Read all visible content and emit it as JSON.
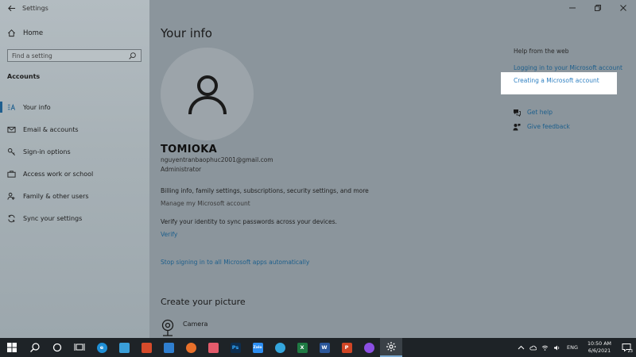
{
  "window": {
    "title": "Settings"
  },
  "sidebar": {
    "home_label": "Home",
    "search_placeholder": "Find a setting",
    "section_title": "Accounts",
    "items": [
      {
        "label": "Your info",
        "icon": "person-card-icon",
        "active": true
      },
      {
        "label": "Email & accounts",
        "icon": "email-icon",
        "active": false
      },
      {
        "label": "Sign-in options",
        "icon": "key-icon",
        "active": false
      },
      {
        "label": "Access work or school",
        "icon": "briefcase-icon",
        "active": false
      },
      {
        "label": "Family & other users",
        "icon": "people-icon",
        "active": false
      },
      {
        "label": "Sync your settings",
        "icon": "sync-icon",
        "active": false
      }
    ]
  },
  "main": {
    "page_title": "Your info",
    "user": {
      "name": "TOMIOKA",
      "email": "nguyentranbaophuc2001@gmail.com",
      "role": "Administrator"
    },
    "billing_text": "Billing info, family settings, subscriptions, security settings, and more",
    "manage_link": "Manage my Microsoft account",
    "verify_text": "Verify your identity to sync passwords across your devices.",
    "verify_link": "Verify",
    "stop_link": "Stop signing in to all Microsoft apps automatically",
    "picture_section_title": "Create your picture",
    "camera_label": "Camera"
  },
  "help": {
    "title": "Help from the web",
    "links": [
      "Logging in to your Microsoft account",
      "Creating a Microsoft account"
    ],
    "get_help": "Get help",
    "give_feedback": "Give feedback"
  },
  "taskbar": {
    "apps": [
      {
        "name": "Edge",
        "letter": "e",
        "color": "#1f8fd6"
      },
      {
        "name": "Store",
        "letter": "",
        "color": "#3a9fd9"
      },
      {
        "name": "Microsoft Store",
        "letter": "",
        "color": "#d64b2b"
      },
      {
        "name": "Mail",
        "letter": "",
        "color": "#2f7fd0"
      },
      {
        "name": "Firefox",
        "letter": "",
        "color": "#e8702a"
      },
      {
        "name": "Photos",
        "letter": "",
        "color": "#e35b6b"
      },
      {
        "name": "Photoshop",
        "letter": "Ps",
        "color": "#0d2d4e"
      },
      {
        "name": "Zalo",
        "letter": "Zalo",
        "color": "#2c8ef2"
      },
      {
        "name": "Browser",
        "letter": "",
        "color": "#34a6dd"
      },
      {
        "name": "Excel",
        "letter": "X",
        "color": "#1f7a43"
      },
      {
        "name": "Word",
        "letter": "W",
        "color": "#2a5699"
      },
      {
        "name": "PowerPoint",
        "letter": "P",
        "color": "#d04525"
      },
      {
        "name": "Messenger",
        "letter": "",
        "color": "#8b4fe3"
      }
    ],
    "language": "ENG",
    "time": "10:50 AM",
    "date": "6/6/2021",
    "notification_count": "23"
  },
  "colors": {
    "accent": "#1d5f8c",
    "highlight_link": "#2d7fc1",
    "taskbar": "#1e2327"
  }
}
